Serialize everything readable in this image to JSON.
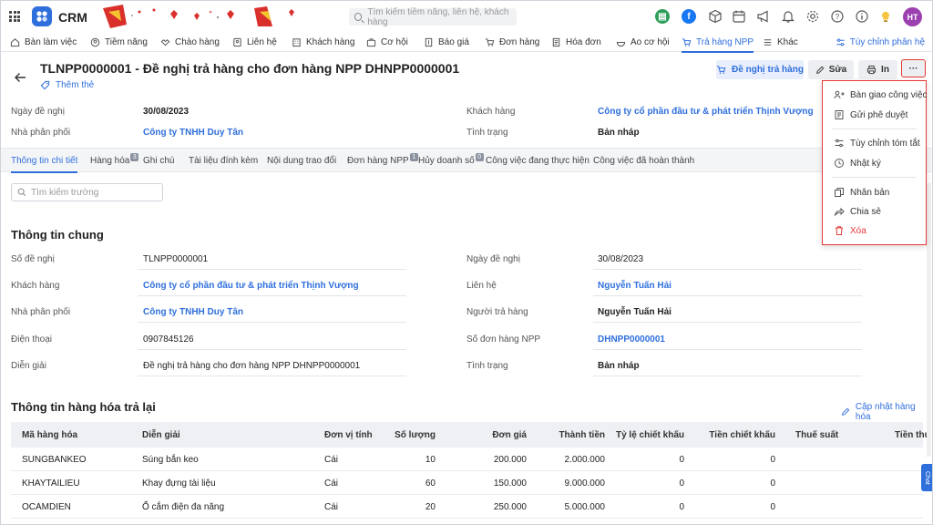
{
  "app": {
    "title": "CRM",
    "user_initials": "HT"
  },
  "search": {
    "placeholder": "Tìm kiếm tiềm năng, liên hệ, khách hàng"
  },
  "nav": {
    "items": [
      "Bàn làm việc",
      "Tiềm năng",
      "Chào hàng",
      "Liên hệ",
      "Khách hàng",
      "Cơ hội",
      "Báo giá",
      "Đơn hàng",
      "Hóa đơn",
      "Ao cơ hội",
      "Trả hàng NPP",
      "Khác"
    ],
    "active": "Trả hàng NPP",
    "customize": "Tùy chỉnh phân hệ"
  },
  "record": {
    "title": "TLNPP0000001 - Đề nghị trả hàng cho đơn hàng NPP DHNPP0000001",
    "add_tag": "Thêm thẻ",
    "buttons": {
      "propose": "Đề nghị trả hàng",
      "edit": "Sửa",
      "print": "In",
      "more": "···"
    },
    "header_fields": {
      "date_label": "Ngày đề nghị",
      "date_value": "30/08/2023",
      "distributor_label": "Nhà phân phối",
      "distributor_value": "Công ty TNHH Duy Tân",
      "customer_label": "Khách hàng",
      "customer_value": "Công ty cổ phần đầu tư & phát triển Thịnh Vượng",
      "status_label": "Tình trạng",
      "status_value": "Bản nháp"
    }
  },
  "tabs": [
    {
      "label": "Thông tin chi tiết",
      "badge": ""
    },
    {
      "label": "Hàng hóa",
      "badge": "3"
    },
    {
      "label": "Ghi chú",
      "badge": ""
    },
    {
      "label": "Tài liệu đính kèm",
      "badge": ""
    },
    {
      "label": "Nội dung trao đổi",
      "badge": ""
    },
    {
      "label": "Đơn hàng NPP",
      "badge": "1"
    },
    {
      "label": "Hủy doanh số",
      "badge": "0"
    },
    {
      "label": "Công việc đang thực hiện",
      "badge": ""
    },
    {
      "label": "Công việc đã hoàn thành",
      "badge": ""
    }
  ],
  "field_search": {
    "placeholder": "Tìm kiếm trường"
  },
  "general": {
    "title": "Thông tin chung",
    "left": [
      {
        "label": "Số đề nghị",
        "value": "TLNPP0000001"
      },
      {
        "label": "Khách hàng",
        "value": "Công ty cổ phần đầu tư & phát triển Thịnh Vượng"
      },
      {
        "label": "Nhà phân phối",
        "value": "Công ty TNHH Duy Tân"
      },
      {
        "label": "Điện thoại",
        "value": "0907845126"
      },
      {
        "label": "Diễn giải",
        "value": "Đề nghị trả hàng cho đơn hàng NPP DHNPP0000001"
      }
    ],
    "right": [
      {
        "label": "Ngày đề nghị",
        "value": "30/08/2023"
      },
      {
        "label": "Liên hệ",
        "value": "Nguyễn Tuấn Hải"
      },
      {
        "label": "Người trả hàng",
        "value": "Nguyễn Tuấn Hải"
      },
      {
        "label": "Số đơn hàng NPP",
        "value": "DHNPP0000001"
      },
      {
        "label": "Tình trạng",
        "value": "Bản nháp"
      }
    ]
  },
  "goods": {
    "title": "Thông tin hàng hóa trả lại",
    "update_label": "Cập nhật hàng hóa",
    "columns": [
      "Mã hàng hóa",
      "Diễn giải",
      "Đơn vị tính",
      "Số lượng",
      "Đơn giá",
      "Thành tiền",
      "Tỷ lệ chiết khấu",
      "Tiền chiết khấu",
      "Thuế suất",
      "Tiền thu"
    ],
    "rows": [
      [
        "SUNGBANKEO",
        "Súng bắn keo",
        "Cái",
        "10",
        "200.000",
        "2.000.000",
        "0",
        "0"
      ],
      [
        "KHAYTAILIEU",
        "Khay đựng tài liệu",
        "Cái",
        "60",
        "150.000",
        "9.000.000",
        "0",
        "0"
      ],
      [
        "OCAMDIEN",
        "Ổ cắm điện đa năng",
        "Cái",
        "20",
        "250.000",
        "5.000.000",
        "0",
        "0"
      ]
    ]
  },
  "more_menu": {
    "items": [
      "Bàn giao công việc",
      "Gửi phê duyệt",
      "Tùy chỉnh tóm tắt",
      "Nhật ký",
      "Nhân bản",
      "Chia sẻ",
      "Xóa"
    ]
  },
  "chat_label": "Chat",
  "colors": {
    "accent": "#2f6fdc",
    "danger": "#e53935",
    "avatar": "#9c3fb0"
  }
}
